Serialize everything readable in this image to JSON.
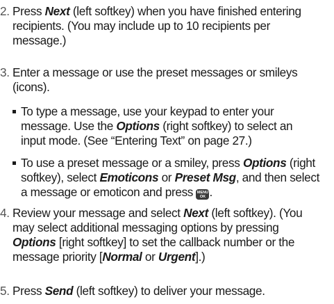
{
  "steps": [
    {
      "number": "2.",
      "lines": [
        [
          "Press ",
          {
            "em": "Next"
          },
          " (left softkey) when you have finished entering"
        ],
        [
          "recipients. (You may include up to 10 recipients per"
        ],
        [
          "message.)"
        ]
      ]
    },
    {
      "number": "3.",
      "lines": [
        [
          "Enter a message or use the preset messages or smileys"
        ],
        [
          "(icons)."
        ]
      ],
      "bullets": [
        {
          "lines": [
            [
              "To type a message, use your keypad to enter your"
            ],
            [
              "message. Use the ",
              {
                "em": "Options"
              },
              " (right softkey) to select an"
            ],
            [
              "input mode. (See “Entering Text” on page 27.)"
            ]
          ]
        },
        {
          "lines": [
            [
              "To use a preset message or a smiley, press ",
              {
                "em": "Options"
              },
              " (right"
            ],
            [
              "softkey), select ",
              {
                "em": "Emoticons"
              },
              " or ",
              {
                "em": "Preset Msg"
              },
              ", and then select"
            ],
            [
              "a message or emoticon and press ",
              {
                "icon": "menu-ok-key-icon"
              },
              "."
            ]
          ]
        }
      ]
    },
    {
      "number": "4.",
      "lines": [
        [
          "Review your message and select ",
          {
            "em": "Next"
          },
          " (left softkey). (You"
        ],
        [
          "may select additional messaging options by pressing"
        ],
        [
          {
            "em": "Options"
          },
          " [right softkey] to set the callback number or the"
        ],
        [
          "message priority [",
          {
            "em": "Normal"
          },
          " or ",
          {
            "em": "Urgent"
          },
          "].)"
        ]
      ]
    },
    {
      "number": "5.",
      "lines": [
        [
          "Press ",
          {
            "em": "Send"
          },
          " (left softkey) to deliver your message."
        ]
      ]
    }
  ],
  "menu_key": {
    "top": "MENU",
    "bottom": "OK"
  }
}
